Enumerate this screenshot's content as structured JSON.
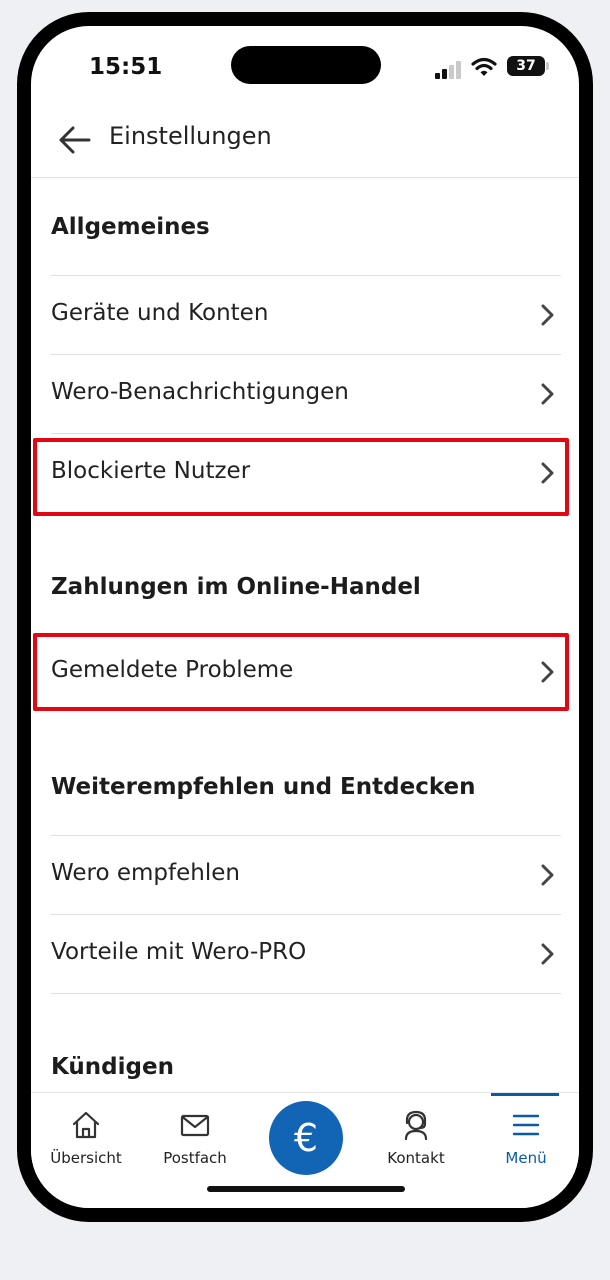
{
  "status": {
    "time": "15:51",
    "battery": "37"
  },
  "header": {
    "title": "Einstellungen"
  },
  "sections": {
    "general": {
      "title": "Allgemeines",
      "items": [
        "Geräte und Konten",
        "Wero-Benachrichtigungen",
        "Blockierte Nutzer"
      ]
    },
    "online": {
      "title": "Zahlungen im Online-Handel",
      "items": [
        "Gemeldete Probleme"
      ]
    },
    "recommend": {
      "title": "Weiterempfehlen und Entdecken",
      "items": [
        "Wero empfehlen",
        "Vorteile mit Wero-PRO"
      ]
    },
    "cancel": {
      "title": "Kündigen"
    }
  },
  "tabbar": {
    "items": [
      "Übersicht",
      "Postfach",
      "€",
      "Kontakt",
      "Menü"
    ],
    "active": "Menü"
  },
  "colors": {
    "accent": "#0b5aa8",
    "euro_button": "#1165b4",
    "highlight": "#e30613"
  }
}
